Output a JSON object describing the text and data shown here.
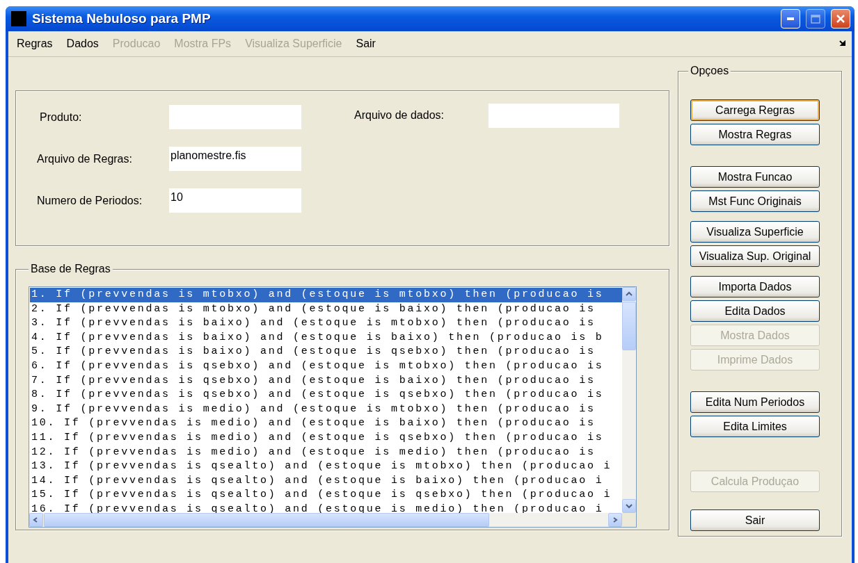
{
  "window": {
    "title": "Sistema Nebuloso para PMP",
    "maximize_disabled": true
  },
  "menu": [
    {
      "label": "Regras",
      "disabled": false
    },
    {
      "label": "Dados",
      "disabled": false
    },
    {
      "label": "Producao",
      "disabled": true
    },
    {
      "label": "Mostra FPs",
      "disabled": true
    },
    {
      "label": "Visualiza Superficie",
      "disabled": true
    },
    {
      "label": "Sair",
      "disabled": false
    }
  ],
  "form": {
    "fields": [
      {
        "label": "Produto:"
      },
      {
        "label": "Arquivo de Regras:",
        "value": "planomestre.fis"
      },
      {
        "label": "Numero de Periodos:",
        "value": "10"
      }
    ],
    "data_file": {
      "label": "Arquivo de dados:"
    }
  },
  "rules": {
    "title": "Base de Regras",
    "items": [
      {
        "text": "1. If (prevvendas is mtobxo) and (estoque is mtobxo) then (producao is",
        "selected": true
      },
      {
        "text": "2. If (prevvendas is mtobxo) and (estoque is baixo) then (producao is",
        "selected": false
      },
      {
        "text": "3. If (prevvendas is baixo) and (estoque is mtobxo) then (producao is",
        "selected": false
      },
      {
        "text": "4. If (prevvendas is baixo) and (estoque is baixo) then (producao is b",
        "selected": false
      },
      {
        "text": "5. If (prevvendas is baixo) and (estoque is qsebxo) then (producao is",
        "selected": false
      },
      {
        "text": "6. If (prevvendas is qsebxo) and (estoque is mtobxo) then (producao is",
        "selected": false
      },
      {
        "text": "7. If (prevvendas is qsebxo) and (estoque is baixo) then (producao is",
        "selected": false
      },
      {
        "text": "8. If (prevvendas is qsebxo) and (estoque is qsebxo) then (producao is",
        "selected": false
      },
      {
        "text": "9. If (prevvendas is medio) and (estoque is mtobxo) then (producao is",
        "selected": false
      },
      {
        "text": "10. If (prevvendas is medio) and (estoque is baixo) then (producao is",
        "selected": false
      },
      {
        "text": "11. If (prevvendas is medio) and (estoque is qsebxo) then (producao is",
        "selected": false
      },
      {
        "text": "12. If (prevvendas is medio) and (estoque is medio) then (producao is",
        "selected": false
      },
      {
        "text": "13. If (prevvendas is qsealto) and (estoque is mtobxo) then (producao i",
        "selected": false
      },
      {
        "text": "14. If (prevvendas is qsealto) and (estoque is baixo) then (producao i",
        "selected": false
      },
      {
        "text": "15. If (prevvendas is qsealto) and (estoque is qsebxo) then (producao i",
        "selected": false
      },
      {
        "text": "16. If (prevvendas is qsealto) and (estoque is medio) then (producao i",
        "selected": false
      }
    ]
  },
  "options": {
    "title": "Opçoes",
    "groups": [
      [
        {
          "label": "Carrega Regras",
          "disabled": false,
          "focused": true
        },
        {
          "label": "Mostra Regras",
          "disabled": false,
          "focused": false
        }
      ],
      [
        {
          "label": "Mostra Funcao",
          "disabled": false,
          "focused": false
        },
        {
          "label": "Mst Func Originais",
          "disabled": false,
          "focused": false
        }
      ],
      [
        {
          "label": "Visualiza Superficie",
          "disabled": false,
          "focused": false
        },
        {
          "label": "Visualiza Sup. Original",
          "disabled": false,
          "focused": false
        }
      ],
      [
        {
          "label": "Importa Dados",
          "disabled": false,
          "focused": false
        },
        {
          "label": "Edita Dados",
          "disabled": false,
          "focused": false
        },
        {
          "label": "Mostra Dados",
          "disabled": true,
          "focused": false
        },
        {
          "label": "Imprime Dados",
          "disabled": true,
          "focused": false
        }
      ],
      [
        {
          "label": "Edita Num Periodos",
          "disabled": false,
          "focused": false
        },
        {
          "label": "Edita Limites",
          "disabled": false,
          "focused": false
        }
      ],
      [
        {
          "label": "Calcula Produçao",
          "disabled": true,
          "focused": false
        }
      ],
      [
        {
          "label": "Sair",
          "disabled": false,
          "focused": false
        }
      ]
    ]
  }
}
